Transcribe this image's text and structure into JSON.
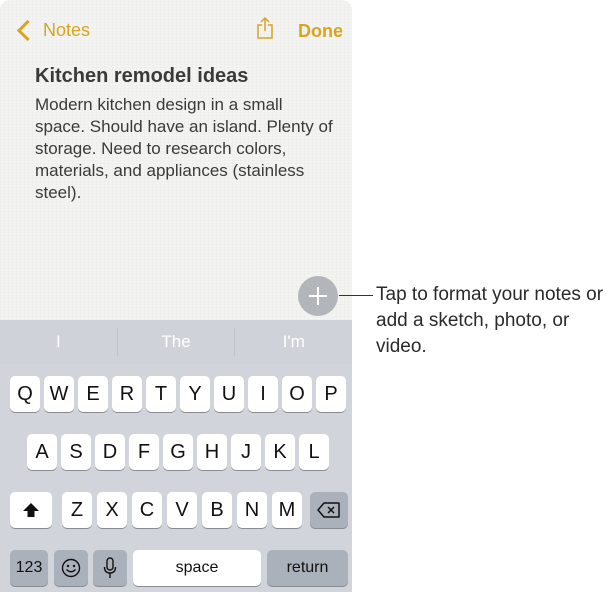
{
  "nav": {
    "back_label": "Notes",
    "done_label": "Done"
  },
  "note": {
    "title": "Kitchen remodel ideas",
    "body": "Modern kitchen design in a small space. Should have an island. Plenty of storage. Need to research colors, materials, and appliances (stainless steel)."
  },
  "callout": {
    "text": "Tap to format your notes or add a sketch, photo, or video."
  },
  "keyboard": {
    "predictions": [
      "I",
      "The",
      "I'm"
    ],
    "row1": [
      "Q",
      "W",
      "E",
      "R",
      "T",
      "Y",
      "U",
      "I",
      "O",
      "P"
    ],
    "row2": [
      "A",
      "S",
      "D",
      "F",
      "G",
      "H",
      "J",
      "K",
      "L"
    ],
    "row3": [
      "Z",
      "X",
      "C",
      "V",
      "B",
      "N",
      "M"
    ],
    "numbers_label": "123",
    "space_label": "space",
    "return_label": "return"
  },
  "colors": {
    "accent": "#d9a420",
    "keyboard_bg": "#d1d5db"
  }
}
